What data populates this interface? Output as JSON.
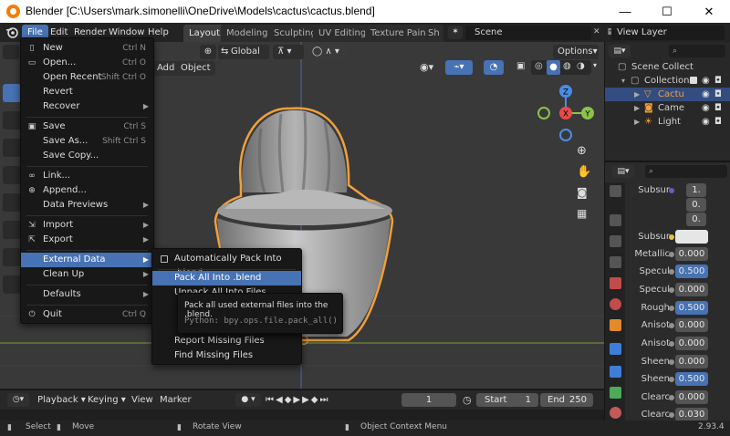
{
  "window": {
    "title": "Blender [C:\\Users\\mark.simonelli\\OneDrive\\Models\\cactus\\cactus.blend]",
    "minimize": "—",
    "maximize": "☐",
    "close": "✕"
  },
  "topmenu": {
    "file": "File",
    "edit": "Edit",
    "render": "Render",
    "window": "Window",
    "help": "Help"
  },
  "workspace_tabs": [
    "Layout",
    "Modeling",
    "Sculpting",
    "UV Editing",
    "Texture Paint",
    "Sh"
  ],
  "scene_field": "Scene",
  "view_layer_field": "View Layer",
  "viewport": {
    "transform_orientation": "Global",
    "add_menu": "Add",
    "object_menu": "Object",
    "options": "Options",
    "gizmo_axes": {
      "z": "Z",
      "x": "X",
      "y": "Y"
    },
    "accent_colors": {
      "x": "#e84b4b",
      "y": "#8bc34a",
      "z": "#4a8de8",
      "origin": "#f2a03b"
    }
  },
  "outliner": {
    "items": [
      {
        "label": "Scene Collect"
      },
      {
        "label": "Collection"
      },
      {
        "label": "Cactu"
      },
      {
        "label": "Came"
      },
      {
        "label": "Light"
      }
    ]
  },
  "properties": {
    "rows": [
      {
        "label": "Subsur",
        "values": [
          "1.",
          "0.",
          "0."
        ]
      },
      {
        "label": "Subsur",
        "value": ""
      },
      {
        "label": "Metallic",
        "value": "0.000"
      },
      {
        "label": "Specul",
        "value": "0.500"
      },
      {
        "label": "Specul",
        "value": "0.000"
      },
      {
        "label": "Rough",
        "value": "0.500"
      },
      {
        "label": "Anisot",
        "value": "0.000"
      },
      {
        "label": "Anisot",
        "value": "0.000"
      },
      {
        "label": "Sheen",
        "value": "0.000"
      },
      {
        "label": "Sheen",
        "value": "0.500"
      },
      {
        "label": "Clearc",
        "value": "0.000"
      },
      {
        "label": "Clearc",
        "value": "0.030"
      }
    ]
  },
  "file_menu": {
    "items": [
      {
        "label": "New",
        "shortcut": "Ctrl N",
        "icon": "new-file-icon"
      },
      {
        "label": "Open...",
        "shortcut": "Ctrl O",
        "icon": "folder-icon"
      },
      {
        "label": "Open Recent",
        "shortcut": "Shift Ctrl O"
      },
      {
        "label": "Revert",
        "shortcut": ""
      },
      {
        "label": "Recover",
        "shortcut": ""
      },
      {
        "label": "Save",
        "shortcut": "Ctrl S",
        "icon": "save-icon"
      },
      {
        "label": "Save As...",
        "shortcut": "Shift Ctrl S"
      },
      {
        "label": "Save Copy...",
        "shortcut": ""
      },
      {
        "label": "Link...",
        "shortcut": "",
        "icon": "link-icon"
      },
      {
        "label": "Append...",
        "shortcut": "",
        "icon": "append-icon"
      },
      {
        "label": "Data Previews",
        "shortcut": ""
      },
      {
        "label": "Import",
        "shortcut": "",
        "icon": "import-icon"
      },
      {
        "label": "Export",
        "shortcut": "",
        "icon": "export-icon"
      },
      {
        "label": "External Data",
        "shortcut": ""
      },
      {
        "label": "Clean Up",
        "shortcut": ""
      },
      {
        "label": "Defaults",
        "shortcut": ""
      },
      {
        "label": "Quit",
        "shortcut": "Ctrl Q",
        "icon": "quit-icon"
      }
    ]
  },
  "external_data_menu": {
    "items": [
      {
        "label": "Automatically Pack Into .blend"
      },
      {
        "label": "Pack All Into .blend"
      },
      {
        "label": "Unpack All Into Files"
      },
      {
        "label": "Report Missing Files"
      },
      {
        "label": "Find Missing Files"
      }
    ]
  },
  "tooltip": {
    "description": "Pack all used external files into the .blend.",
    "python": "Python: bpy.ops.file.pack_all()"
  },
  "timeline": {
    "playback": "Playback",
    "keying": "Keying",
    "view": "View",
    "marker": "Marker",
    "current_frame": "1",
    "start_label": "Start",
    "start_value": "1",
    "end_label": "End",
    "end_value": "250"
  },
  "statusbar": {
    "select": "Select",
    "move": "Move",
    "rotate_view": "Rotate View",
    "object_context": "Object Context Menu",
    "version": "2.93.4"
  }
}
